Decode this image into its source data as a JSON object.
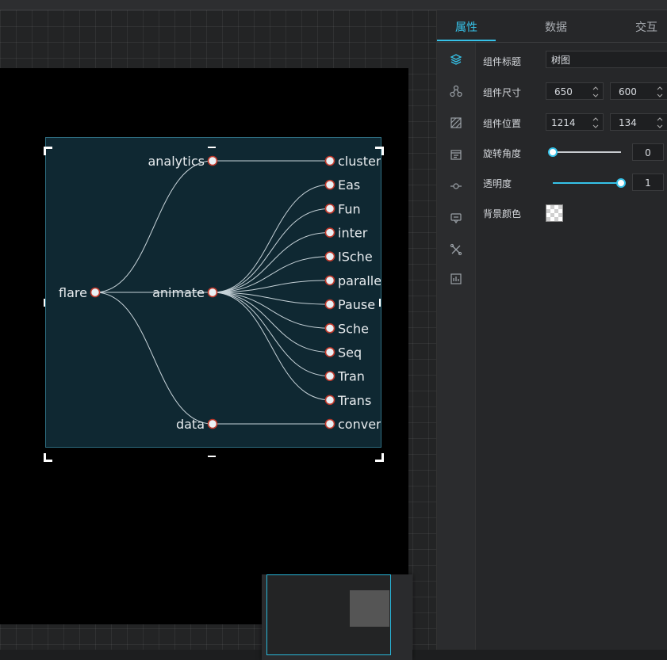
{
  "tabs": [
    {
      "label": "属性",
      "active": true
    },
    {
      "label": "数据",
      "active": false
    },
    {
      "label": "交互",
      "active": false
    }
  ],
  "rail_icons": [
    "layers-icon",
    "nodes-icon",
    "texture-icon",
    "calendar-icon",
    "axis-icon",
    "tooltip-icon",
    "tools-icon",
    "chart-icon"
  ],
  "properties": {
    "title_label": "组件标题",
    "title_value": "树图",
    "size_label": "组件尺寸",
    "width": "650",
    "height": "600",
    "position_label": "组件位置",
    "pos_x": "1214",
    "pos_y": "134",
    "rotation_label": "旋转角度",
    "rotation_value": "0",
    "rotation_fraction": 0,
    "opacity_label": "透明度",
    "opacity_value": "1",
    "opacity_fraction": 1,
    "bg_color_label": "背景颜色"
  },
  "tree": {
    "root": "flare",
    "branches": [
      {
        "name": "analytics",
        "children": [
          "cluster"
        ]
      },
      {
        "name": "animate",
        "children": [
          "Eas",
          "Fun",
          "inter",
          "ISche",
          "parallel",
          "Pause",
          "Sche",
          "Seq",
          "Tran",
          "Trans"
        ]
      },
      {
        "name": "data",
        "children": [
          "conver"
        ]
      }
    ]
  },
  "colors": {
    "accent": "#36c2e8",
    "widget_bg": "#0f2832",
    "node_stroke": "#c0392b"
  }
}
